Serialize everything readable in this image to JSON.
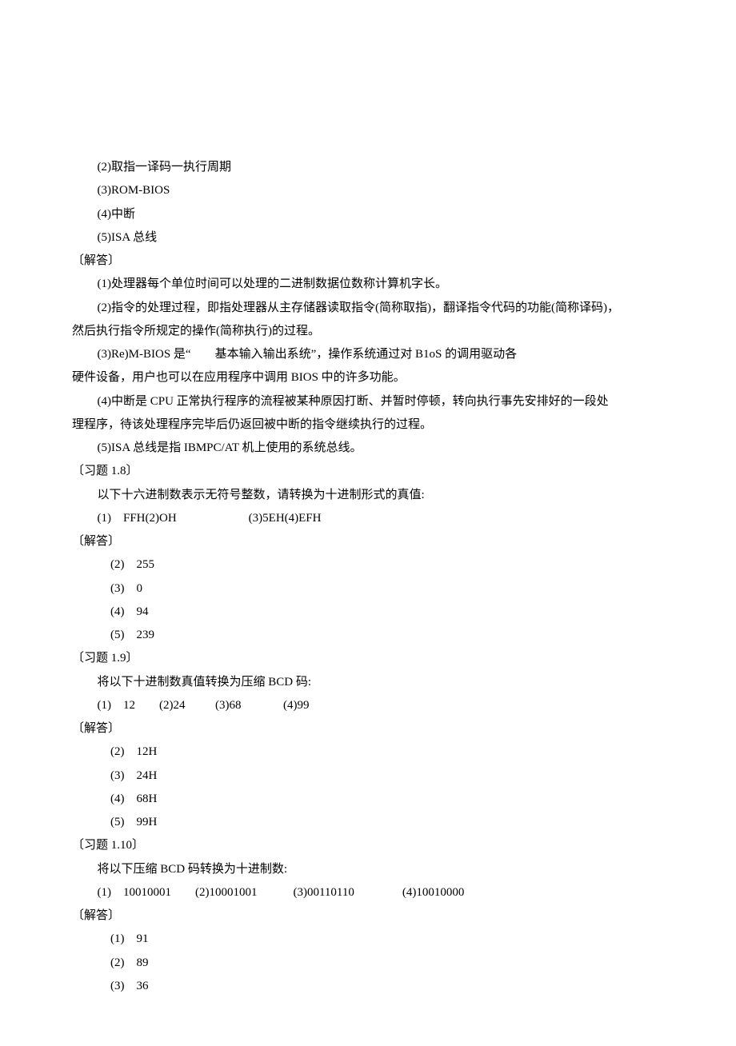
{
  "lines": [
    {
      "cls": "indent-1",
      "text": "(2)取指一译码一执行周期"
    },
    {
      "cls": "indent-1",
      "text": "(3)ROM-BIOS"
    },
    {
      "cls": "indent-1",
      "text": "(4)中断"
    },
    {
      "cls": "indent-1",
      "text": "(5)ISA 总线"
    },
    {
      "cls": "",
      "text": "〔解答〕"
    },
    {
      "cls": "indent-1",
      "text": "(1)处理器每个单位时间可以处理的二进制数据位数称计算机字长。"
    },
    {
      "cls": "indent-1",
      "text": "(2)指令的处理过程，即指处理器从主存储器读取指令(简称取指)，翻译指令代码的功能(简称译码)，"
    },
    {
      "cls": "",
      "text": "然后执行指令所规定的操作(简称执行)的过程。"
    },
    {
      "cls": "indent-1",
      "text": "(3)Re)M-BIOS 是“        基本输入输出系统”，操作系统通过对 B1oS 的调用驱动各"
    },
    {
      "cls": "",
      "text": "硬件设备，用户也可以在应用程序中调用 BIOS 中的许多功能。"
    },
    {
      "cls": "indent-1",
      "text": "(4)中断是 CPU 正常执行程序的流程被某种原因打断、并暂时停顿，转向执行事先安排好的一段处"
    },
    {
      "cls": "",
      "text": "理程序，待该处理程序完毕后仍返回被中断的指令继续执行的过程。"
    },
    {
      "cls": "indent-1",
      "text": "(5)ISA 总线是指 IBMPC/AT 机上使用的系统总线。"
    },
    {
      "cls": "",
      "text": "〔习题 1.8〕"
    },
    {
      "cls": "indent-1",
      "text": "以下十六进制数表示无符号整数，请转换为十进制形式的真值:"
    },
    {
      "cls": "indent-1",
      "text": "(1)    FFH(2)OH                        (3)5EH(4)EFH"
    },
    {
      "cls": "",
      "text": "〔解答〕"
    },
    {
      "cls": "indent-list",
      "text": "(2)    255"
    },
    {
      "cls": "indent-list",
      "text": "(3)    0"
    },
    {
      "cls": "indent-list",
      "text": "(4)    94"
    },
    {
      "cls": "indent-list",
      "text": "(5)    239"
    },
    {
      "cls": "",
      "text": "〔习题 1.9〕"
    },
    {
      "cls": "indent-1",
      "text": "将以下十进制数真值转换为压缩 BCD 码:"
    },
    {
      "cls": "indent-1",
      "text": "(1)    12        (2)24          (3)68              (4)99"
    },
    {
      "cls": "",
      "text": "〔解答〕"
    },
    {
      "cls": "indent-list",
      "text": "(2)    12H"
    },
    {
      "cls": "indent-list",
      "text": "(3)    24H"
    },
    {
      "cls": "indent-list",
      "text": "(4)    68H"
    },
    {
      "cls": "indent-list",
      "text": "(5)    99H"
    },
    {
      "cls": "",
      "text": "〔习题 1.10〕"
    },
    {
      "cls": "indent-1",
      "text": "将以下压缩 BCD 码转换为十进制数:"
    },
    {
      "cls": "indent-1",
      "text": "(1)    10010001        (2)10001001            (3)00110110                (4)10010000"
    },
    {
      "cls": "",
      "text": "〔解答〕"
    },
    {
      "cls": "indent-list",
      "text": "(1)    91"
    },
    {
      "cls": "indent-list",
      "text": "(2)    89"
    },
    {
      "cls": "indent-list",
      "text": "(3)    36"
    }
  ]
}
